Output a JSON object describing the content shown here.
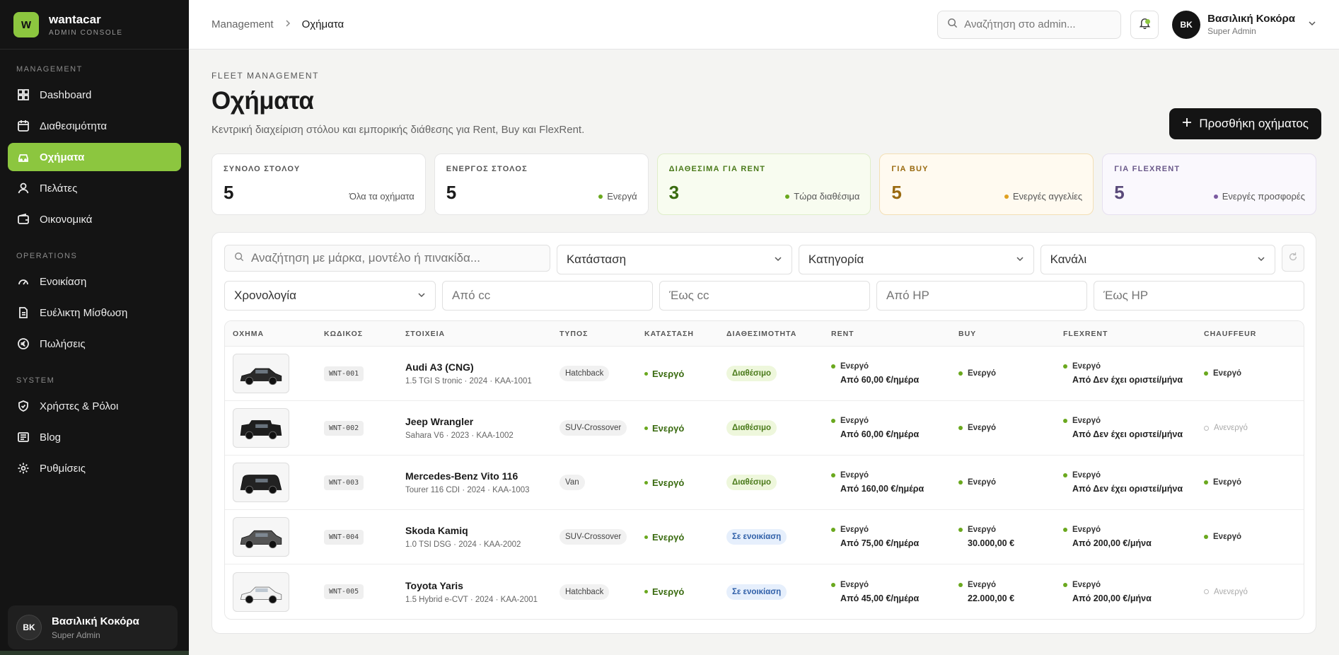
{
  "brand": {
    "logo_letter": "w",
    "name": "wantacar",
    "subtitle": "ADMIN CONSOLE",
    "accent": "#8cc63f"
  },
  "sidebar": {
    "sections": [
      {
        "title": "MANAGEMENT",
        "items": [
          {
            "label": "Dashboard",
            "icon": "dashboard-icon"
          },
          {
            "label": "Διαθεσιμότητα",
            "icon": "calendar-icon"
          },
          {
            "label": "Οχήματα",
            "icon": "car-icon",
            "active": true
          },
          {
            "label": "Πελάτες",
            "icon": "user-icon"
          },
          {
            "label": "Οικονομικά",
            "icon": "wallet-icon"
          }
        ]
      },
      {
        "title": "OPERATIONS",
        "items": [
          {
            "label": "Ενοικίαση",
            "icon": "gauge-icon"
          },
          {
            "label": "Ευέλικτη Μίσθωση",
            "icon": "document-icon"
          },
          {
            "label": "Πωλήσεις",
            "icon": "euro-icon"
          }
        ]
      },
      {
        "title": "SYSTEM",
        "items": [
          {
            "label": "Χρήστες & Ρόλοι",
            "icon": "shield-icon"
          },
          {
            "label": "Blog",
            "icon": "newspaper-icon"
          },
          {
            "label": "Ρυθμίσεις",
            "icon": "gear-icon"
          }
        ]
      }
    ],
    "user": {
      "initials": "ΒΚ",
      "name": "Βασιλική Κοκόρα",
      "role": "Super Admin"
    }
  },
  "topbar": {
    "breadcrumb": [
      "Management",
      "Οχήματα"
    ],
    "search_placeholder": "Αναζήτηση στο admin...",
    "user": {
      "initials": "ΒΚ",
      "name": "Βασιλική Κοκόρα",
      "role": "Super Admin"
    }
  },
  "page": {
    "eyebrow": "FLEET MANAGEMENT",
    "title": "Οχήματα",
    "subtitle": "Κεντρική διαχείριση στόλου και εμπορικής διάθεσης για Rent, Buy και FlexRent.",
    "add_button": "Προσθήκη οχήματος"
  },
  "stats": [
    {
      "label": "ΣΥΝΟΛΟ ΣΤΟΛΟΥ",
      "value": "5",
      "note": "Όλα τα οχήματα",
      "dot": ""
    },
    {
      "label": "ΕΝΕΡΓΟΣ ΣΤΟΛΟΣ",
      "value": "5",
      "note": "Ενεργά",
      "dot": "#6aa81e"
    },
    {
      "label": "ΔΙΑΘΕΣΙΜΑ ΓΙΑ RENT",
      "value": "3",
      "note": "Τώρα διαθέσιμα",
      "dot": "#6aa81e"
    },
    {
      "label": "ΓΙΑ BUY",
      "value": "5",
      "note": "Ενεργές αγγελίες",
      "dot": "#e0a020"
    },
    {
      "label": "ΓΙΑ FLEXRENT",
      "value": "5",
      "note": "Ενεργές προσφορές",
      "dot": "#7a5aa0"
    }
  ],
  "filters": {
    "search_placeholder": "Αναζήτηση με μάρκα, μοντέλο ή πινακίδα...",
    "status": "Κατάσταση",
    "category": "Κατηγορία",
    "channel": "Κανάλι",
    "year": "Χρονολογία",
    "cc_from": "Από cc",
    "cc_to": "Έως cc",
    "hp_from": "Από HP",
    "hp_to": "Έως HP"
  },
  "table": {
    "headers": [
      "ΟΧΗΜΑ",
      "ΚΩΔΙΚΟΣ",
      "ΣΤΟΙΧΕΙΑ",
      "ΤΥΠΟΣ",
      "ΚΑΤΑΣΤΑΣΗ",
      "ΔΙΑΘΕΣΙΜΟΤΗΤΑ",
      "RENT",
      "BUY",
      "FLEXRENT",
      "CHAUFFEUR"
    ],
    "rows": [
      {
        "code": "WNT-001",
        "name": "Audi A3 (CNG)",
        "details": "1.5 TGI S tronic · 2024 · ΚΑΑ-1001",
        "type": "Hatchback",
        "status": "Ενεργό",
        "availability": "Διαθέσιμο",
        "avail_kind": "free",
        "rent": "Ενεργό",
        "rent_price": "Από 60,00 €/ημέρα",
        "buy": "Ενεργό",
        "buy_price": "",
        "flex": "Ενεργό",
        "flex_price": "Από Δεν έχει οριστεί/μήνα",
        "chauffeur": "Ενεργό",
        "chauffeur_on": true,
        "car_kind": "sedan"
      },
      {
        "code": "WNT-002",
        "name": "Jeep Wrangler",
        "details": "Sahara V6 · 2023 · ΚΑΑ-1002",
        "type": "SUV-Crossover",
        "status": "Ενεργό",
        "availability": "Διαθέσιμο",
        "avail_kind": "free",
        "rent": "Ενεργό",
        "rent_price": "Από 60,00 €/ημέρα",
        "buy": "Ενεργό",
        "buy_price": "",
        "flex": "Ενεργό",
        "flex_price": "Από Δεν έχει οριστεί/μήνα",
        "chauffeur": "Ανενεργό",
        "chauffeur_on": false,
        "car_kind": "jeep"
      },
      {
        "code": "WNT-003",
        "name": "Mercedes-Benz Vito 116",
        "details": "Tourer 116 CDI · 2024 · ΚΑΑ-1003",
        "type": "Van",
        "status": "Ενεργό",
        "availability": "Διαθέσιμο",
        "avail_kind": "free",
        "rent": "Ενεργό",
        "rent_price": "Από 160,00 €/ημέρα",
        "buy": "Ενεργό",
        "buy_price": "",
        "flex": "Ενεργό",
        "flex_price": "Από Δεν έχει οριστεί/μήνα",
        "chauffeur": "Ενεργό",
        "chauffeur_on": true,
        "car_kind": "van"
      },
      {
        "code": "WNT-004",
        "name": "Skoda Kamiq",
        "details": "1.0 TSI DSG · 2024 · ΚΑΑ-2002",
        "type": "SUV-Crossover",
        "status": "Ενεργό",
        "availability": "Σε ενοικίαση",
        "avail_kind": "rent",
        "rent": "Ενεργό",
        "rent_price": "Από 75,00 €/ημέρα",
        "buy": "Ενεργό",
        "buy_price": "30.000,00 €",
        "flex": "Ενεργό",
        "flex_price": "Από 200,00 €/μήνα",
        "chauffeur": "Ενεργό",
        "chauffeur_on": true,
        "car_kind": "suv"
      },
      {
        "code": "WNT-005",
        "name": "Toyota Yaris",
        "details": "1.5 Hybrid e-CVT · 2024 · ΚΑΑ-2001",
        "type": "Hatchback",
        "status": "Ενεργό",
        "availability": "Σε ενοικίαση",
        "avail_kind": "rent",
        "rent": "Ενεργό",
        "rent_price": "Από 45,00 €/ημέρα",
        "buy": "Ενεργό",
        "buy_price": "22.000,00 €",
        "flex": "Ενεργό",
        "flex_price": "Από 200,00 €/μήνα",
        "chauffeur": "Ανενεργό",
        "chauffeur_on": false,
        "car_kind": "white-hatch"
      }
    ]
  }
}
